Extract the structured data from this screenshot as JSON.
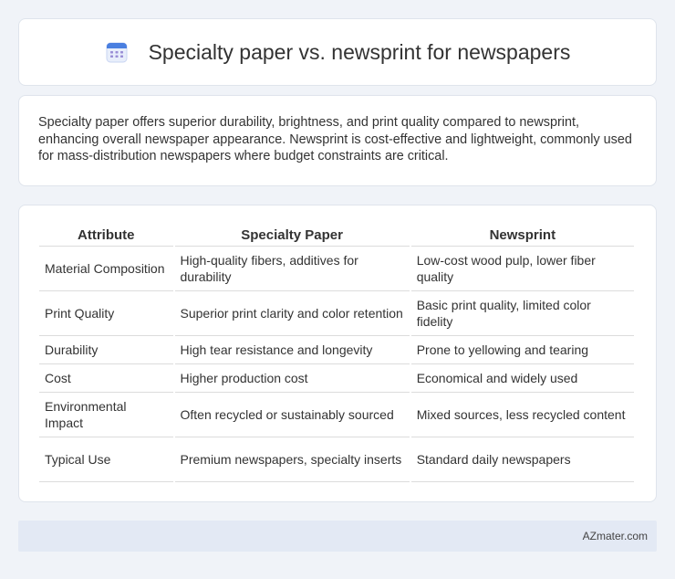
{
  "header": {
    "title": "Specialty paper vs. newsprint for newspapers",
    "icon": "calendar-icon"
  },
  "summary": {
    "text": "Specialty paper offers superior durability, brightness, and print quality compared to newsprint, enhancing overall newspaper appearance. Newsprint is cost-effective and lightweight, commonly used for mass-distribution newspapers where budget constraints are critical."
  },
  "table": {
    "headers": [
      "Attribute",
      "Specialty Paper",
      "Newsprint"
    ],
    "rows": [
      [
        "Material Composition",
        "High-quality fibers, additives for durability",
        "Low-cost wood pulp, lower fiber quality"
      ],
      [
        "Print Quality",
        "Superior print clarity and color retention",
        "Basic print quality, limited color fidelity"
      ],
      [
        "Durability",
        "High tear resistance and longevity",
        "Prone to yellowing and tearing"
      ],
      [
        "Cost",
        "Higher production cost",
        "Economical and widely used"
      ],
      [
        "Environmental Impact",
        "Often recycled or sustainably sourced",
        "Mixed sources, less recycled content"
      ],
      [
        "Typical Use",
        "Premium newspapers, specialty inserts",
        "Standard daily newspapers"
      ]
    ]
  },
  "footer": {
    "brand": "AZmater.com"
  },
  "colors": {
    "background": "#f0f3f8",
    "card": "#ffffff",
    "footer_bar": "#e3e9f4",
    "icon_blue": "#4a7fe0"
  }
}
